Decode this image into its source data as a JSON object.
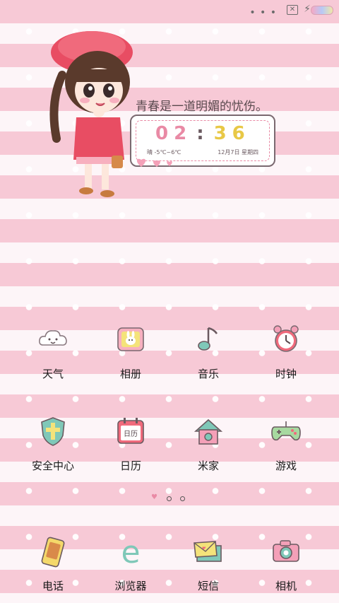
{
  "status_bar": {
    "more_dots": "• • •",
    "sim_icon": "sim-card-icon",
    "charging_icon": "charging-bolt-icon",
    "battery_icon": "battery-icon"
  },
  "widget": {
    "quote": "青春是一道明媚的忧伤。",
    "time_hour": "02",
    "time_sep": ":",
    "time_min": "36",
    "weather": "晴 -5℃~6℃",
    "date": "12月7日 星期四"
  },
  "apps": [
    {
      "label": "天气",
      "icon": "cloud-icon"
    },
    {
      "label": "相册",
      "icon": "bunny-frame-icon"
    },
    {
      "label": "音乐",
      "icon": "music-note-icon"
    },
    {
      "label": "时钟",
      "icon": "alarm-clock-icon"
    },
    {
      "label": "安全中心",
      "icon": "shield-icon"
    },
    {
      "label": "日历",
      "icon": "calendar-icon"
    },
    {
      "label": "米家",
      "icon": "house-icon"
    },
    {
      "label": "游戏",
      "icon": "gamepad-icon"
    }
  ],
  "dock": [
    {
      "label": "电话",
      "icon": "phone-icon"
    },
    {
      "label": "浏览器",
      "icon": "browser-e-icon"
    },
    {
      "label": "短信",
      "icon": "message-envelope-icon"
    },
    {
      "label": "相机",
      "icon": "camera-icon"
    }
  ],
  "calendar_icon_text": "日历",
  "browser_icon_text": "e",
  "pager": {
    "pages": 3,
    "current": 1
  },
  "colors": {
    "pink": "#f7c9d6",
    "accent_pink": "#e98aa5",
    "yellow": "#e8c846",
    "text": "#1a1a1a"
  }
}
